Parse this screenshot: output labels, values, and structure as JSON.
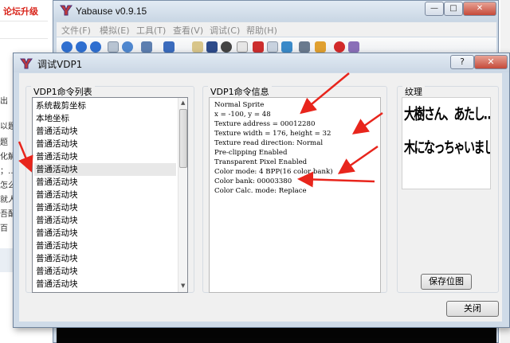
{
  "background": {
    "forum_text": "论坛升级",
    "left_fragments": [
      "出",
      "以题",
      "题",
      "化解",
      "；…",
      "怎么",
      "就人",
      "吾配",
      "百"
    ]
  },
  "main_window": {
    "title": "Yabause v0.9.15",
    "menu": [
      "文件(F)",
      "模拟(E)",
      "工具(T)",
      "查看(V)",
      "调试(C)",
      "帮助(H)"
    ],
    "controls": {
      "minimize": "—",
      "maximize": "□",
      "close": "✕"
    }
  },
  "dialog": {
    "title": "调试VDP1",
    "help_button": "?",
    "close_x": "✕",
    "list_group_title": "VDP1命令列表",
    "info_group_title": "VDP1命令信息",
    "texture_group_title": "纹理",
    "list_items": [
      {
        "label": "系统裁剪坐标",
        "selected": false
      },
      {
        "label": "本地坐标",
        "selected": false
      },
      {
        "label": "普通活动块",
        "selected": false
      },
      {
        "label": "普通活动块",
        "selected": false
      },
      {
        "label": "普通活动块",
        "selected": false
      },
      {
        "label": "普通活动块",
        "selected": true
      },
      {
        "label": "普通活动块",
        "selected": false
      },
      {
        "label": "普通活动块",
        "selected": false
      },
      {
        "label": "普通活动块",
        "selected": false
      },
      {
        "label": "普通活动块",
        "selected": false
      },
      {
        "label": "普通活动块",
        "selected": false
      },
      {
        "label": "普通活动块",
        "selected": false
      },
      {
        "label": "普通活动块",
        "selected": false
      },
      {
        "label": "普通活动块",
        "selected": false
      },
      {
        "label": "普通活动块",
        "selected": false
      }
    ],
    "info_lines": [
      "Normal Sprite",
      "x = -100, y = 48",
      "Texture address = 00012280",
      "Texture width = 176, height = 32",
      "Texture read direction: Normal",
      "Pre-clipping Enabled",
      "Transparent Pixel Enabled",
      "Color mode: 4 BPP(16 color bank)",
      "Color bank: 00003380",
      "Color Calc. mode: Replace"
    ],
    "texture_lines": [
      "大樹さん、あたし……",
      "木になっちゃいました……"
    ],
    "save_button": "保存位图",
    "close_button": "关闭"
  },
  "colors": {
    "annotation_red": "#e8251c",
    "window_frame": "#cdd9e6",
    "dialog_bg": "#f0f0f0",
    "forum_red": "#d9261c"
  }
}
